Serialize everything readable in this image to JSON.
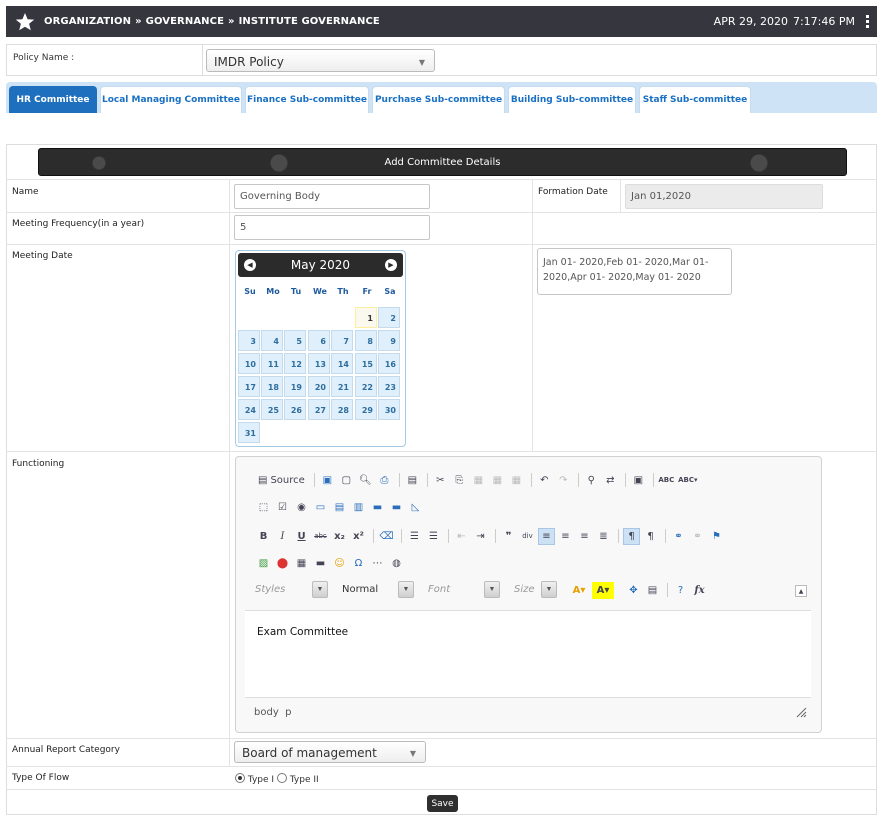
{
  "header": {
    "breadcrumb": [
      "ORGANIZATION",
      "»",
      "GOVERNANCE",
      "»",
      "INSTITUTE GOVERNANCE"
    ],
    "date": "APR 29, 2020",
    "time": "7:17:46 PM"
  },
  "policy": {
    "label": "Policy Name :",
    "value": "IMDR Policy"
  },
  "tabs": [
    {
      "label": "HR Committee",
      "active": true
    },
    {
      "label": "Local Managing Committee"
    },
    {
      "label": "Finance Sub-committee"
    },
    {
      "label": "Purchase Sub-committee"
    },
    {
      "label": "Building Sub-committee"
    },
    {
      "label": "Staff Sub-committee"
    }
  ],
  "form": {
    "title": "Add Committee Details",
    "name_label": "Name",
    "name_value": "Governing Body",
    "formation_label": "Formation Date",
    "formation_value": "Jan 01,2020",
    "frequency_label": "Meeting Frequency(in a year)",
    "frequency_value": "5",
    "meeting_date_label": "Meeting Date",
    "meeting_dates": "Jan 01- 2020,Feb 01- 2020,Mar 01- 2020,Apr 01- 2020,May 01- 2020",
    "functioning_label": "Functioning",
    "annual_label": "Annual Report Category",
    "annual_value": "Board of management",
    "flow_label": "Type Of Flow",
    "flow_option1": "Type I",
    "flow_option2": "Type II",
    "save_label": "Save"
  },
  "calendar": {
    "month": "May 2020",
    "dow": [
      "Su",
      "Mo",
      "Tu",
      "We",
      "Th",
      "Fr",
      "Sa"
    ],
    "today": "1",
    "days": [
      "1",
      "2",
      "3",
      "4",
      "5",
      "6",
      "7",
      "8",
      "9",
      "10",
      "11",
      "12",
      "13",
      "14",
      "15",
      "16",
      "17",
      "18",
      "19",
      "20",
      "21",
      "22",
      "23",
      "24",
      "25",
      "26",
      "27",
      "28",
      "29",
      "30",
      "31"
    ]
  },
  "editor": {
    "source_label": "Source",
    "styles_placeholder": "Styles",
    "format_value": "Normal",
    "font_placeholder": "Font",
    "size_placeholder": "Size",
    "content": "Exam Committee",
    "status_path": "body  p"
  }
}
